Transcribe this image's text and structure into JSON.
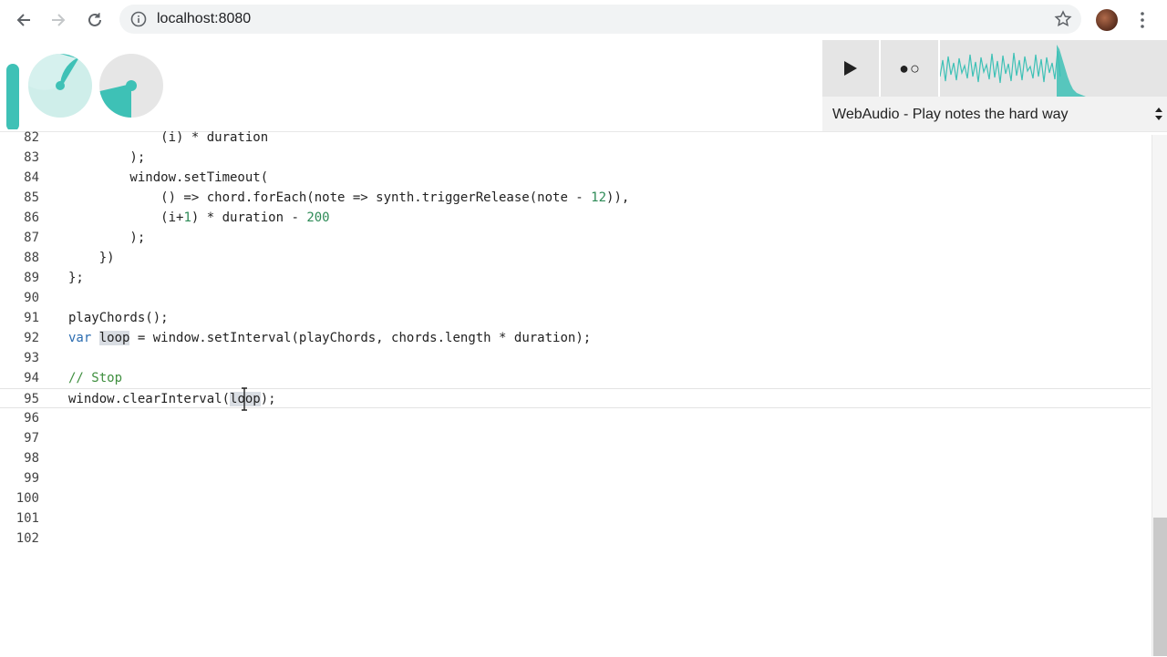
{
  "browser": {
    "url": "localhost:8080",
    "icons": [
      "back-icon",
      "forward-icon",
      "reload-icon",
      "info-icon",
      "star-icon",
      "avatar",
      "menu-icon"
    ]
  },
  "app": {
    "accent": "#3ec1b6",
    "transport": {
      "play_icon": "play-icon",
      "record_label": "●○"
    },
    "example_select": {
      "selected": "WebAudio - Play notes the hard way"
    }
  },
  "editor": {
    "lines": [
      {
        "n": "82",
        "text": "            (i) * duration"
      },
      {
        "n": "83",
        "text": "        );"
      },
      {
        "n": "84",
        "text": "        window.setTimeout("
      },
      {
        "n": "85",
        "text": "            () => chord.forEach(note => synth.triggerRelease(note - 12)),"
      },
      {
        "n": "86",
        "text": "            (i+1) * duration - 200"
      },
      {
        "n": "87",
        "text": "        );"
      },
      {
        "n": "88",
        "text": "    })"
      },
      {
        "n": "89",
        "text": "};"
      },
      {
        "n": "90",
        "text": ""
      },
      {
        "n": "91",
        "text": "playChords();"
      },
      {
        "n": "92",
        "text": "var loop = window.setInterval(playChords, chords.length * duration);"
      },
      {
        "n": "93",
        "text": ""
      },
      {
        "n": "94",
        "text": "// Stop"
      },
      {
        "n": "95",
        "text": "window.clearInterval(loop);"
      },
      {
        "n": "96",
        "text": ""
      },
      {
        "n": "97",
        "text": ""
      },
      {
        "n": "98",
        "text": ""
      },
      {
        "n": "99",
        "text": ""
      },
      {
        "n": "100",
        "text": ""
      },
      {
        "n": "101",
        "text": ""
      },
      {
        "n": "102",
        "text": ""
      }
    ],
    "active_line": "95"
  }
}
